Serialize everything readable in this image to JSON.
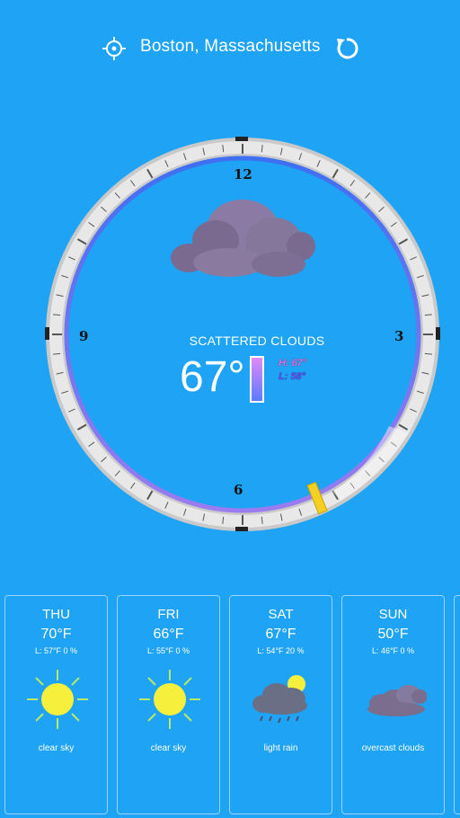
{
  "header": {
    "location": "Boston, Massachusetts",
    "locate_icon": "crosshair-icon",
    "refresh_icon": "refresh-icon"
  },
  "clock": {
    "labels": [
      "12",
      "3",
      "6",
      "9"
    ]
  },
  "current": {
    "condition": "SCATTERED CLOUDS",
    "temperature": "67°",
    "high": "H: 67°",
    "low": "L: 58°",
    "icon": "cloud-icon"
  },
  "forecast": [
    {
      "day": "THU",
      "temp": "70°F",
      "meta": "L: 57°F 0 %",
      "desc": "clear sky",
      "icon": "sun-icon"
    },
    {
      "day": "FRI",
      "temp": "66°F",
      "meta": "L: 55°F 0 %",
      "desc": "clear sky",
      "icon": "sun-icon"
    },
    {
      "day": "SAT",
      "temp": "67°F",
      "meta": "L: 54°F 20 %",
      "desc": "light rain",
      "icon": "rain-cloud-icon"
    },
    {
      "day": "SUN",
      "temp": "50°F",
      "meta": "L: 46°F 0 %",
      "desc": "overcast clouds",
      "icon": "overcast-clouds-icon"
    }
  ],
  "colors": {
    "background": "#1fa3f4",
    "ring": "#d7d7d7",
    "accent_ring": "#3a7cf5",
    "marker": "#f5d020"
  }
}
